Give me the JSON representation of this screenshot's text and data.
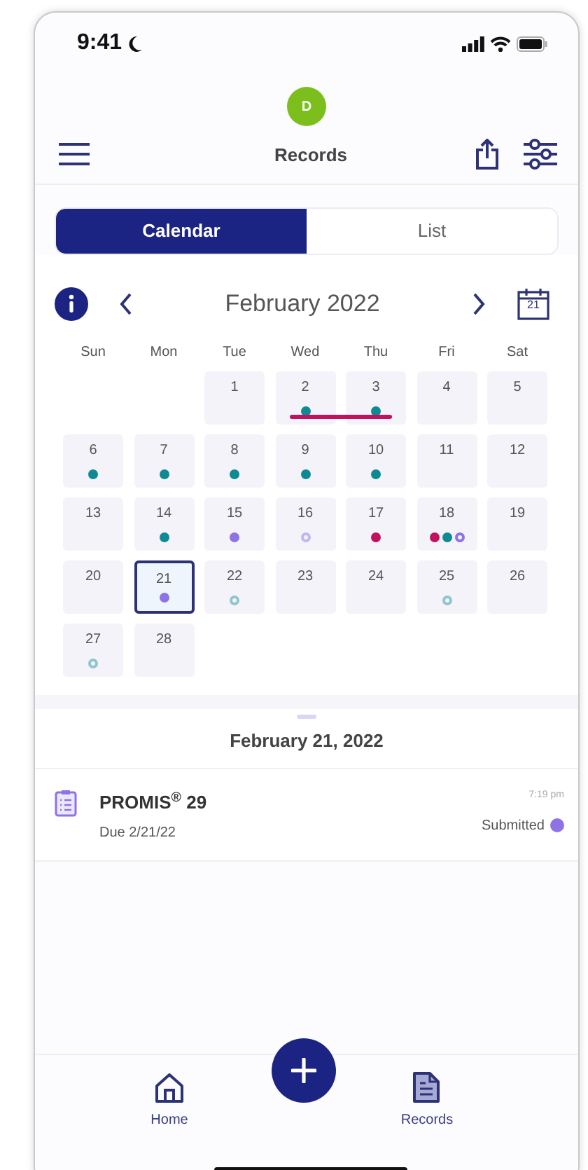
{
  "status_bar": {
    "time": "9:41"
  },
  "header": {
    "avatar": "D",
    "title": "Records"
  },
  "segments": [
    {
      "label": "Calendar",
      "selected": true
    },
    {
      "label": "List",
      "selected": false
    }
  ],
  "calendar": {
    "month": "February 2022",
    "today_icon": "21",
    "weekdays": [
      "Sun",
      "Mon",
      "Tue",
      "Wed",
      "Thu",
      "Fri",
      "Sat"
    ],
    "weeks": [
      {
        "days": [
          {
            "kind": "empty"
          },
          {
            "kind": "empty"
          },
          {
            "kind": "day",
            "num": "1",
            "selected": false
          },
          {
            "kind": "day",
            "num": "2",
            "selected": false,
            "color": "#c0125f",
            "dots": [
              {
                "color": "#0f8a93",
                "filled": true
              }
            ]
          },
          {
            "kind": "day",
            "num": "3",
            "selected": false,
            "color": "#c0125f",
            "dots": [
              {
                "color": "#0f8a93",
                "filled": true
              }
            ]
          },
          {
            "kind": "day",
            "num": "4",
            "selected": false
          },
          {
            "kind": "day",
            "num": "5",
            "selected": false
          }
        ]
      },
      {
        "days": [
          {
            "kind": "day",
            "num": "6",
            "selected": false,
            "dots": [
              {
                "color": "#0f8a93",
                "filled": true
              }
            ]
          },
          {
            "kind": "day",
            "num": "7",
            "selected": false,
            "dots": [
              {
                "color": "#0f8a93",
                "filled": true
              }
            ]
          },
          {
            "kind": "day",
            "num": "8",
            "selected": false,
            "dots": [
              {
                "color": "#0f8a93",
                "filled": true
              }
            ]
          },
          {
            "kind": "day",
            "num": "9",
            "selected": false,
            "dots": [
              {
                "color": "#0f8a93",
                "filled": true
              }
            ]
          },
          {
            "kind": "day",
            "num": "10",
            "selected": false,
            "dots": [
              {
                "color": "#0f8a93",
                "filled": true
              }
            ]
          },
          {
            "kind": "day",
            "num": "11",
            "selected": false
          },
          {
            "kind": "day",
            "num": "12",
            "selected": false
          }
        ]
      },
      {
        "days": [
          {
            "kind": "day",
            "num": "13",
            "selected": false
          },
          {
            "kind": "day",
            "num": "14",
            "selected": false,
            "dots": [
              {
                "color": "#0f8a93",
                "filled": true
              }
            ]
          },
          {
            "kind": "day",
            "num": "15",
            "selected": false,
            "dots": [
              {
                "color": "#8e72e6",
                "filled": true
              }
            ]
          },
          {
            "kind": "day",
            "num": "16",
            "selected": false,
            "dots": [
              {
                "color": "#c4b6f0",
                "filled": false
              }
            ]
          },
          {
            "kind": "day",
            "num": "17",
            "selected": false,
            "dots": [
              {
                "color": "#c0125f",
                "filled": true
              }
            ]
          },
          {
            "kind": "day",
            "num": "18",
            "selected": false,
            "dots": [
              {
                "color": "#c0125f",
                "filled": true
              },
              {
                "color": "#0f8a93",
                "filled": true
              },
              {
                "color": "#8e72e6",
                "filled": false
              }
            ]
          },
          {
            "kind": "day",
            "num": "19",
            "selected": false
          }
        ]
      },
      {
        "days": [
          {
            "kind": "day",
            "num": "20",
            "selected": false
          },
          {
            "kind": "day",
            "num": "21",
            "selected": true,
            "dots": [
              {
                "color": "#8e72e6",
                "filled": true
              }
            ]
          },
          {
            "kind": "day",
            "num": "22",
            "selected": false,
            "dots": [
              {
                "color": "#8fc6cc",
                "filled": false
              }
            ]
          },
          {
            "kind": "day",
            "num": "23",
            "selected": false
          },
          {
            "kind": "day",
            "num": "24",
            "selected": false
          },
          {
            "kind": "day",
            "num": "25",
            "selected": false,
            "dots": [
              {
                "color": "#8fc6cc",
                "filled": false
              }
            ]
          },
          {
            "kind": "day",
            "num": "26",
            "selected": false
          }
        ]
      },
      {
        "days": [
          {
            "kind": "day",
            "num": "27",
            "selected": false,
            "dots": [
              {
                "color": "#8fc6cc",
                "filled": false
              }
            ]
          },
          {
            "kind": "day",
            "num": "28",
            "selected": false
          }
        ]
      }
    ]
  },
  "day_panel": {
    "date": "February 21, 2022",
    "items": [
      {
        "title": "PROMIS$^{®}$ 29",
        "due": "Due 2/21/22",
        "time": "7:19 pm",
        "status": "Submitted",
        "color": "#8e72e6"
      }
    ]
  },
  "tab_bar": [
    {
      "label": "Home"
    },
    {
      "label": "Records"
    }
  ]
}
